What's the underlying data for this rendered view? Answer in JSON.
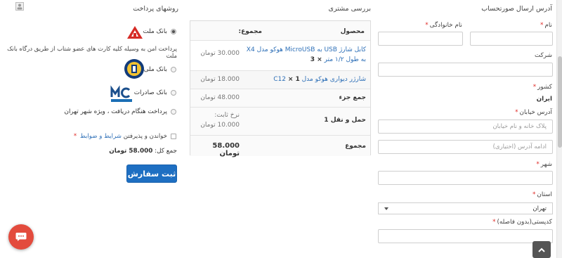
{
  "topbar": {
    "avatar_icon": "user-icon"
  },
  "billing": {
    "title": "آدرس ارسال صورتحساب",
    "first_name_label": "نام",
    "last_name_label": "نام خانوادگی",
    "company_label": "شرکت",
    "country_label": "کشور",
    "country_value": "ایران",
    "street_label": "آدرس خیابان",
    "street_placeholder": "پلاک خانه و نام خیابان",
    "street2_placeholder": "ادامه آدرس (اختیاری)",
    "city_label": "شهر",
    "state_label": "استان",
    "state_value": "تهران",
    "postcode_label": "کدپستی(بدون فاصله)",
    "required_mark": "*"
  },
  "review": {
    "title": "بررسی مشتری",
    "col_product": "محصول",
    "col_total": "مجموع:",
    "items": [
      {
        "name": "کابل شارژ USB به MicroUSB هوکو مدل X4 به طول ۱/۲ متر",
        "qty": "× 3",
        "price": "30.000 تومان"
      },
      {
        "name": "شارژر دیواری هوکو مدل C12",
        "qty": "× 1",
        "price": "18.000 تومان"
      }
    ],
    "subtotal_label": "جمع جزء",
    "subtotal_value": "48.000 تومان",
    "shipping_label": "حمل و نقل 1",
    "shipping_rate_label": "نرخ ثابت:",
    "shipping_value": "10.000 تومان",
    "total_label": "مجموع",
    "total_value": "58.000 تومان"
  },
  "payment": {
    "title": "روشهای پرداخت",
    "methods": [
      {
        "label": "بانک ملت",
        "checked": true
      },
      {
        "label": "بانک ملی",
        "checked": false
      },
      {
        "label": "بانک صادرات",
        "checked": false
      },
      {
        "label": "پرداخت هنگام دریافت ، ویژه شهر تهران",
        "checked": false
      }
    ],
    "mellat_description": "پرداخت امن به وسیله کلیه کارت های عضو شتاب از طریق درگاه بانک ملت",
    "terms_prefix": "خواندن و پذیرفتن",
    "terms_link": "شرایط و ضوابط",
    "grand_total_label": "جمع کل:",
    "grand_total_value": "58.000 تومان",
    "submit_label": "ثبت سفارش"
  },
  "colors": {
    "accent": "#1e6fc2",
    "link": "#2d6fb7",
    "required": "#e02b27",
    "chat": "#e34b3d"
  }
}
